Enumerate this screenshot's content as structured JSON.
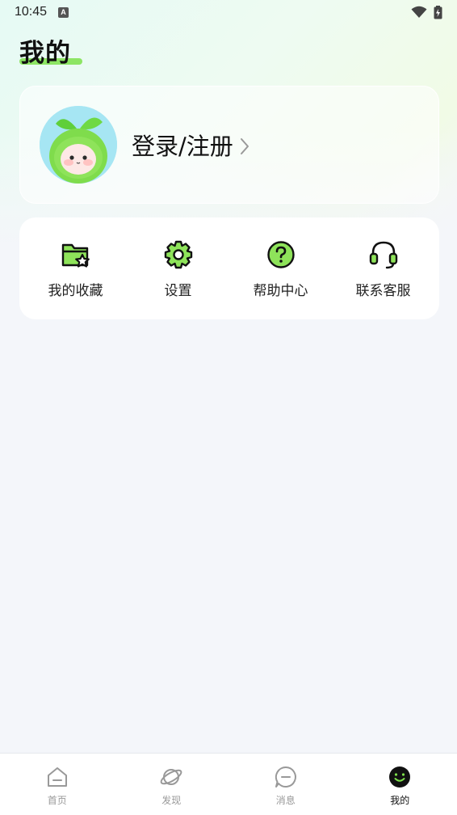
{
  "status_bar": {
    "time": "10:45",
    "notification_icon": "a-letter-icon",
    "wifi_icon": "wifi-icon",
    "battery_icon": "battery-charging-icon"
  },
  "page": {
    "title": "我的"
  },
  "login": {
    "avatar_icon": "sprout-mascot-avatar",
    "label": "登录/注册",
    "chevron_icon": "chevron-right-icon"
  },
  "menu": {
    "items": [
      {
        "label": "我的收藏",
        "icon": "folder-star-icon"
      },
      {
        "label": "设置",
        "icon": "gear-icon"
      },
      {
        "label": "帮助中心",
        "icon": "question-circle-icon"
      },
      {
        "label": "联系客服",
        "icon": "headset-icon"
      }
    ]
  },
  "tabs": [
    {
      "label": "首页",
      "icon": "home-icon",
      "active": false
    },
    {
      "label": "发现",
      "icon": "planet-icon",
      "active": false
    },
    {
      "label": "消息",
      "icon": "message-icon",
      "active": false
    },
    {
      "label": "我的",
      "icon": "smile-icon",
      "active": true
    }
  ],
  "colors": {
    "accent_green": "#7de04a",
    "icon_stroke": "#111111",
    "background": "#f4f6fa",
    "tab_inactive": "#999999",
    "tab_active": "#111111"
  }
}
